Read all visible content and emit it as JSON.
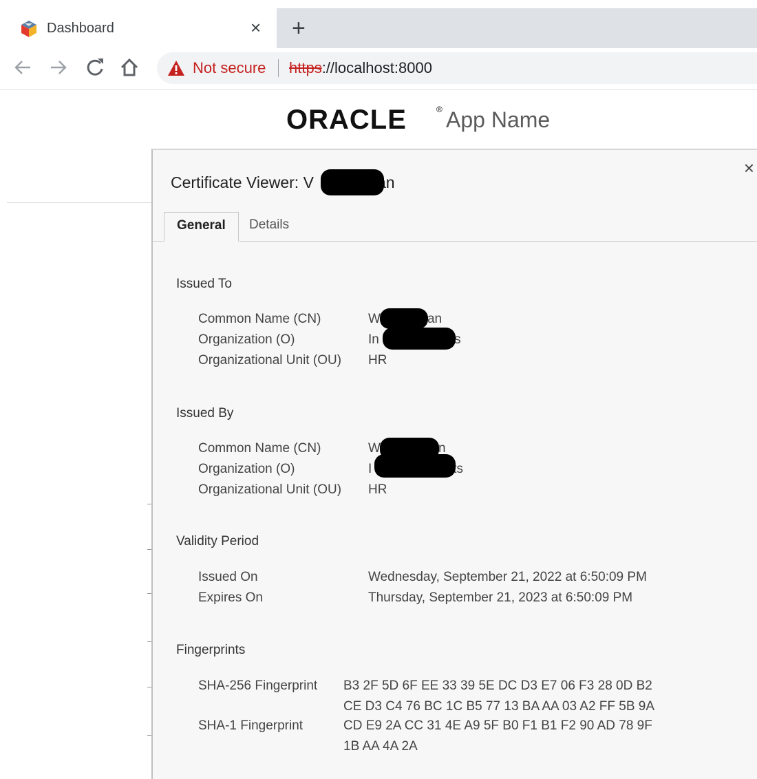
{
  "browser": {
    "tab_title": "Dashboard",
    "tab_close": "×",
    "new_tab": "+",
    "security_text": "Not secure",
    "url_scheme": "https",
    "url_rest": "://localhost:8000"
  },
  "page": {
    "brand": "ORACLE",
    "brand_mark": "®",
    "app_name": "App Name"
  },
  "dialog": {
    "close": "×",
    "title_prefix": "Certificate Viewer: V",
    "title_suffix": "an",
    "tabs": [
      "General",
      "Details"
    ],
    "issued_to": {
      "heading": "Issued To",
      "rows": [
        {
          "label": "Common Name (CN)",
          "value_visible": "W",
          "value_tail": "an"
        },
        {
          "label": "Organization (O)",
          "value_visible": "In",
          "value_tail": "ts"
        },
        {
          "label": "Organizational Unit (OU)",
          "value": "HR"
        }
      ]
    },
    "issued_by": {
      "heading": "Issued By",
      "rows": [
        {
          "label": "Common Name (CN)",
          "value_visible": "W",
          "value_tail": "n"
        },
        {
          "label": "Organization (O)",
          "value_visible": "I",
          "value_tail": "ts"
        },
        {
          "label": "Organizational Unit (OU)",
          "value": "HR"
        }
      ]
    },
    "validity": {
      "heading": "Validity Period",
      "issued_on_label": "Issued On",
      "issued_on": "Wednesday, September 21, 2022 at 6:50:09 PM",
      "expires_on_label": "Expires On",
      "expires_on": "Thursday, September 21, 2023 at 6:50:09 PM"
    },
    "fingerprints": {
      "heading": "Fingerprints",
      "sha256_label": "SHA-256 Fingerprint",
      "sha256_line1": "B3 2F 5D 6F EE 33 39 5E DC D3 E7 06 F3 28 0D B2",
      "sha256_line2": "CE D3 C4 76 BC 1C B5 77 13 BA AA 03 A2 FF 5B 9A",
      "sha1_label": "SHA-1 Fingerprint",
      "sha1_line1": "CD E9 2A CC 31 4E A9 5F B0 F1 B1 F2 90 AD 78 9F",
      "sha1_line2": "1B AA 4A 2A"
    }
  }
}
